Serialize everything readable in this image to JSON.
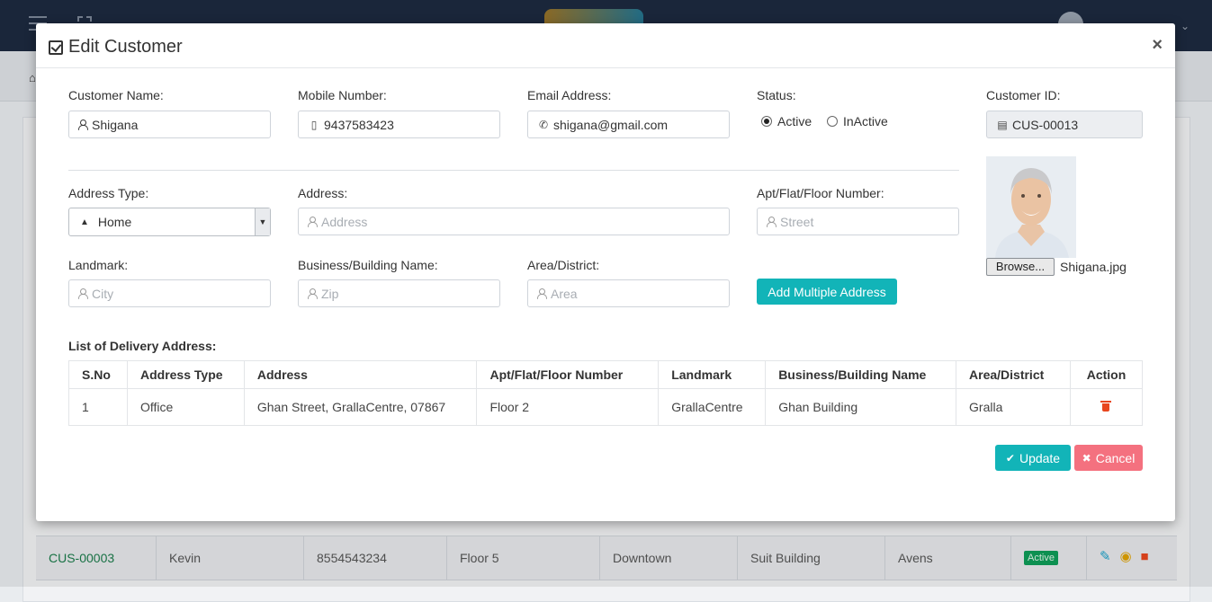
{
  "modal": {
    "title": "Edit Customer",
    "close": "×",
    "icons": {
      "title": "checkbox-edit-icon"
    }
  },
  "customer": {
    "name_label": "Customer Name:",
    "name_value": "Shigana",
    "mobile_label": "Mobile Number:",
    "mobile_value": "9437583423",
    "email_label": "Email Address:",
    "email_value": "shigana@gmail.com",
    "status_label": "Status:",
    "status_active": "Active",
    "status_inactive": "InActive",
    "status_selected": "Active",
    "id_label": "Customer ID:",
    "id_value": "CUS-00013"
  },
  "address_form": {
    "type_label": "Address Type:",
    "type_value": "Home",
    "address_label": "Address:",
    "address_placeholder": "Address",
    "apt_label": "Apt/Flat/Floor Number:",
    "apt_placeholder": "Street",
    "landmark_label": "Landmark:",
    "landmark_placeholder": "City",
    "building_label": "Business/Building Name:",
    "building_placeholder": "Zip",
    "area_label": "Area/District:",
    "area_placeholder": "Area",
    "add_button": "Add Multiple Address"
  },
  "photo": {
    "browse_label": "Browse...",
    "file_name": "Shigana.jpg"
  },
  "delivery_list": {
    "title": "List of Delivery Address:",
    "headers": [
      "S.No",
      "Address Type",
      "Address",
      "Apt/Flat/Floor Number",
      "Landmark",
      "Business/Building Name",
      "Area/District",
      "Action"
    ],
    "rows": [
      [
        "1",
        "Office",
        "Ghan Street, GrallaCentre, 07867",
        "Floor 2",
        "GrallaCentre",
        "Ghan Building",
        "Gralla"
      ]
    ]
  },
  "actions": {
    "update": "Update",
    "cancel": "Cancel"
  },
  "background_row": {
    "id": "CUS-00003",
    "name": "Kevin",
    "mobile": "8554543234",
    "floor": "Floor 5",
    "landmark": "Downtown",
    "building": "Suit Building",
    "area": "Avens",
    "status": "Active"
  },
  "colors": {
    "accent": "#12b4b8",
    "danger": "#f4717f",
    "delete_icon": "#e8461e",
    "topbar": "#1d2a3f"
  }
}
